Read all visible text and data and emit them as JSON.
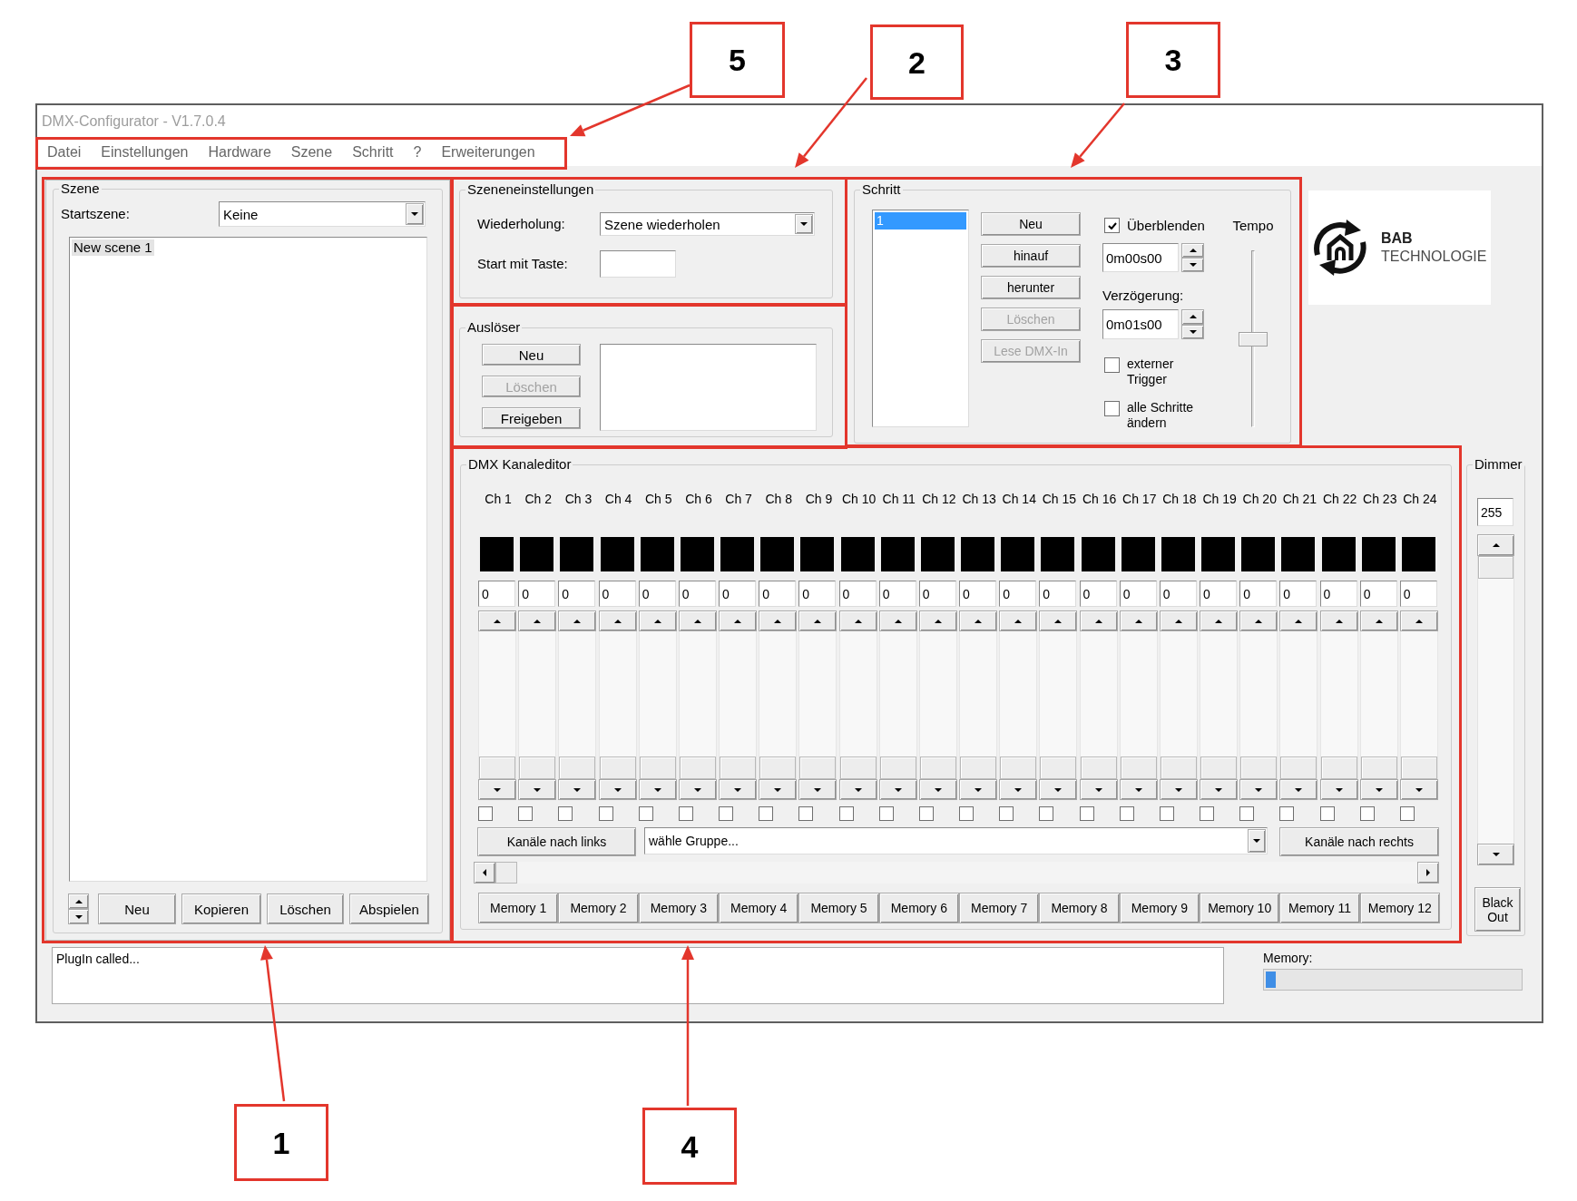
{
  "window": {
    "title": "DMX-Configurator - V1.7.0.4"
  },
  "menu": [
    {
      "label": "Datei"
    },
    {
      "label": "Einstellungen"
    },
    {
      "label": "Hardware"
    },
    {
      "label": "Szene"
    },
    {
      "label": "Schritt"
    },
    {
      "label": "?"
    },
    {
      "label": "Erweiterungen"
    }
  ],
  "scene_panel": {
    "title": "Szene",
    "start_scene": {
      "label": "Startszene:",
      "value": "Keine"
    },
    "scenes": [
      {
        "label": "New scene 1",
        "selected": true
      }
    ],
    "buttons": [
      {
        "label": "Neu"
      },
      {
        "label": "Kopieren"
      },
      {
        "label": "Löschen"
      },
      {
        "label": "Abspielen"
      }
    ]
  },
  "scene_settings": {
    "title": "Szeneneinstellungen",
    "repeat": {
      "label": "Wiederholung:",
      "value": "Szene wiederholen"
    },
    "start_key": {
      "label": "Start mit Taste:"
    }
  },
  "trigger": {
    "title": "Auslöser",
    "buttons": [
      {
        "label": "Neu",
        "disabled": false
      },
      {
        "label": "Löschen",
        "disabled": true
      },
      {
        "label": "Freigeben",
        "disabled": false
      }
    ]
  },
  "step": {
    "title": "Schritt",
    "steps": [
      {
        "label": "1",
        "selected": true
      }
    ],
    "buttons": [
      {
        "label": "Neu",
        "disabled": false
      },
      {
        "label": "hinauf",
        "disabled": false
      },
      {
        "label": "herunter",
        "disabled": false
      },
      {
        "label": "Löschen",
        "disabled": true
      },
      {
        "label": "Lese DMX-In",
        "disabled": true
      }
    ],
    "crossfade": {
      "label": "Überblenden",
      "checked": true
    },
    "crossfade_time": {
      "value": "0m00s00"
    },
    "delay": {
      "label": "Verzögerung:",
      "value": "0m01s00"
    },
    "options": [
      {
        "label": "externer Trigger",
        "checked": false
      },
      {
        "label": "alle Schritte ändern",
        "checked": false
      }
    ],
    "tempo": {
      "label": "Tempo",
      "level": 0.5
    }
  },
  "logo": {
    "name": "BAB",
    "subtitle": "TECHNOLOGIE"
  },
  "channel_editor": {
    "title": "DMX Kanaleditor",
    "channels": [
      {
        "label": "Ch 1",
        "value": "0",
        "level": 0,
        "checked": false
      },
      {
        "label": "Ch 2",
        "value": "0",
        "level": 0,
        "checked": false
      },
      {
        "label": "Ch 3",
        "value": "0",
        "level": 0,
        "checked": false
      },
      {
        "label": "Ch 4",
        "value": "0",
        "level": 0,
        "checked": false
      },
      {
        "label": "Ch 5",
        "value": "0",
        "level": 0,
        "checked": false
      },
      {
        "label": "Ch 6",
        "value": "0",
        "level": 0,
        "checked": false
      },
      {
        "label": "Ch 7",
        "value": "0",
        "level": 0,
        "checked": false
      },
      {
        "label": "Ch 8",
        "value": "0",
        "level": 0,
        "checked": false
      },
      {
        "label": "Ch 9",
        "value": "0",
        "level": 0,
        "checked": false
      },
      {
        "label": "Ch 10",
        "value": "0",
        "level": 0,
        "checked": false
      },
      {
        "label": "Ch 11",
        "value": "0",
        "level": 0,
        "checked": false
      },
      {
        "label": "Ch 12",
        "value": "0",
        "level": 0,
        "checked": false
      },
      {
        "label": "Ch 13",
        "value": "0",
        "level": 0,
        "checked": false
      },
      {
        "label": "Ch 14",
        "value": "0",
        "level": 0,
        "checked": false
      },
      {
        "label": "Ch 15",
        "value": "0",
        "level": 0,
        "checked": false
      },
      {
        "label": "Ch 16",
        "value": "0",
        "level": 0,
        "checked": false
      },
      {
        "label": "Ch 17",
        "value": "0",
        "level": 0,
        "checked": false
      },
      {
        "label": "Ch 18",
        "value": "0",
        "level": 0,
        "checked": false
      },
      {
        "label": "Ch 19",
        "value": "0",
        "level": 0,
        "checked": false
      },
      {
        "label": "Ch 20",
        "value": "0",
        "level": 0,
        "checked": false
      },
      {
        "label": "Ch 21",
        "value": "0",
        "level": 0,
        "checked": false
      },
      {
        "label": "Ch 22",
        "value": "0",
        "level": 0,
        "checked": false
      },
      {
        "label": "Ch 23",
        "value": "0",
        "level": 0,
        "checked": false
      },
      {
        "label": "Ch 24",
        "value": "0",
        "level": 0,
        "checked": false
      }
    ],
    "left_button": {
      "label": "Kanäle nach links"
    },
    "group": {
      "value": "wähle Gruppe..."
    },
    "right_button": {
      "label": "Kanäle nach rechts"
    },
    "memories": [
      {
        "label": "Memory 1"
      },
      {
        "label": "Memory 2"
      },
      {
        "label": "Memory 3"
      },
      {
        "label": "Memory 4"
      },
      {
        "label": "Memory 5"
      },
      {
        "label": "Memory 6"
      },
      {
        "label": "Memory 7"
      },
      {
        "label": "Memory 8"
      },
      {
        "label": "Memory 9"
      },
      {
        "label": "Memory 10"
      },
      {
        "label": "Memory 11"
      },
      {
        "label": "Memory 12"
      }
    ]
  },
  "dimmer": {
    "title": "Dimmer",
    "value": "255",
    "level": 1,
    "blackout": {
      "label": "Black Out"
    }
  },
  "status": {
    "message": "PlugIn called...",
    "memory": {
      "label": "Memory:",
      "level": 0.04
    }
  },
  "callouts": [
    {
      "label": "5"
    },
    {
      "label": "2"
    },
    {
      "label": "3"
    },
    {
      "label": "1"
    },
    {
      "label": "4"
    }
  ]
}
